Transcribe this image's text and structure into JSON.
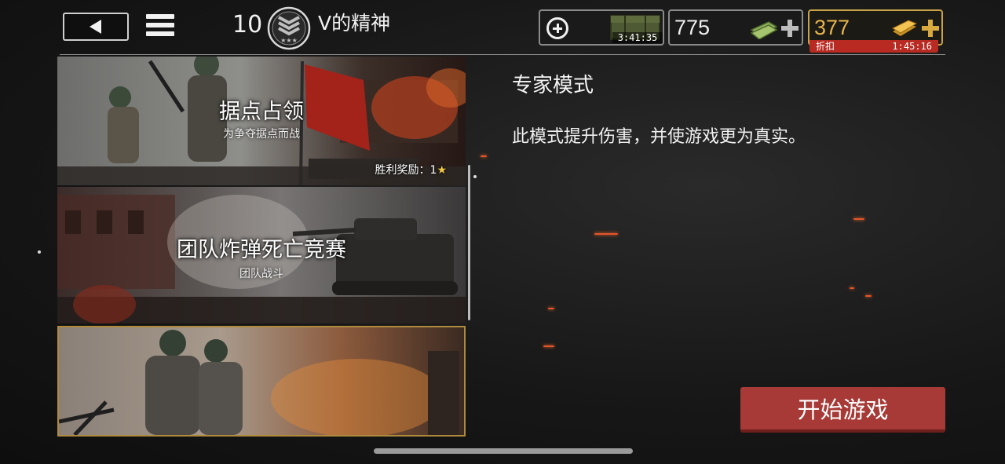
{
  "header": {
    "rank_number": "10",
    "player_name": "V的精神",
    "supply_timer": "3:41:35",
    "cash_amount": "775",
    "gold_amount": "377",
    "discount_label": "折扣",
    "discount_timer": "1:45:16"
  },
  "modes": [
    {
      "title": "据点占领",
      "subtitle": "为争夺据点而战",
      "reward_label": "胜利奖励：1"
    },
    {
      "title": "团队炸弹死亡竞赛",
      "subtitle": "团队战斗"
    },
    {
      "title": "",
      "subtitle": ""
    }
  ],
  "details": {
    "title": "专家模式",
    "description": "此模式提升伤害，并使游戏更为真实。"
  },
  "start_button": {
    "label": "开始游戏"
  },
  "colors": {
    "accent_gold": "#c7a44a",
    "discount_red": "#b92a22",
    "start_button": "#a73a36",
    "selected_card_border": "#b08a3c"
  },
  "icons": {
    "back": "back-arrow-icon",
    "menu": "hamburger-menu-icon",
    "rank": "rank-chevron-badge-icon",
    "supply_add": "plus-circle-icon",
    "supply": "supply-crate-icon",
    "cash": "cash-bill-icon",
    "gold": "gold-bar-icon",
    "add": "plus-icon",
    "star": "star-icon"
  }
}
